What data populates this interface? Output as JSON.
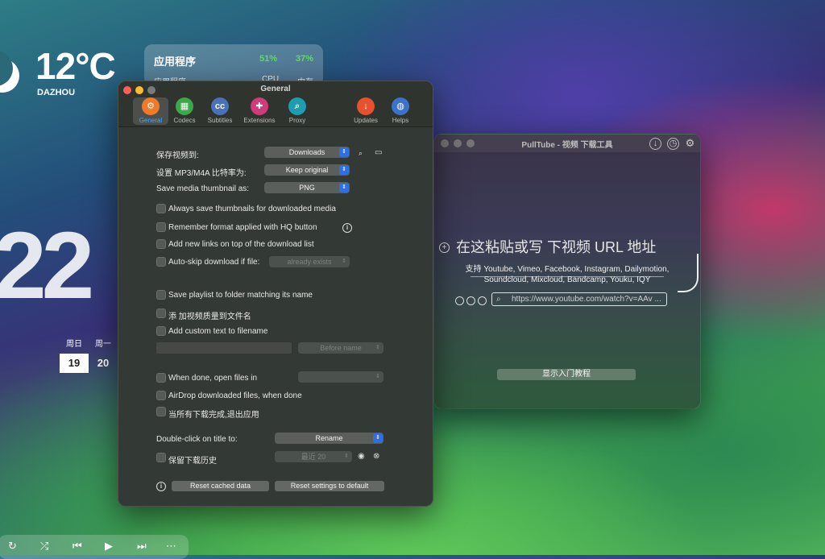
{
  "desktop": {
    "weather": {
      "temp": "12°C",
      "city": "DAZHOU"
    },
    "big_date": "22",
    "calendar": {
      "weekdays": [
        "周日",
        "周一"
      ],
      "days": [
        "19",
        "20"
      ]
    },
    "activity": {
      "title": "应用程序",
      "cpu": "51%",
      "mem": "37%",
      "sub_title": "应用程序",
      "sub_cpu": "CPU",
      "sub_mem": "内存"
    },
    "music": {
      "controls": [
        "↻",
        "⤮",
        "⏮",
        "▶",
        "⏭",
        "⋯"
      ]
    }
  },
  "pulltube": {
    "title": "PullTube - 视频 下载工具",
    "paste_prompt": "在这粘贴或写 下视频 URL 地址",
    "supported_line1": "支持 Youtube, Vimeo, Facebook, Instagram, Dailymotion,",
    "supported_line2": "Soundcloud, Mixcloud, Bandcamp, Youku, IQY",
    "url_placeholder": "https://www.youtube.com/watch?v=AAv ...",
    "guide_button": "显示入门教程",
    "icons": [
      "download-icon",
      "history-icon",
      "gear-icon"
    ]
  },
  "general": {
    "title": "General",
    "toolbar": [
      {
        "label": "General",
        "color": "#f07a2a",
        "glyph": "⚙"
      },
      {
        "label": "Codecs",
        "color": "#3ca84a",
        "glyph": "▦"
      },
      {
        "label": "Subtitles",
        "color": "#4a72b8",
        "glyph": "cc"
      },
      {
        "label": "Extensions",
        "color": "#d23b7a",
        "glyph": "✚"
      },
      {
        "label": "Proxy",
        "color": "#1f9db0",
        "glyph": "⌕"
      },
      {
        "label": "Updates",
        "color": "#e8502e",
        "glyph": "↓"
      },
      {
        "label": "Helps",
        "color": "#3a73c8",
        "glyph": "◍"
      }
    ],
    "save_video_label": "保存视频到:",
    "save_video_value": "Downloads",
    "bitrate_label": "设置 MP3/M4A 比特率为:",
    "bitrate_value": "Keep original",
    "thumb_label": "Save media thumbnail as:",
    "thumb_value": "PNG",
    "opt_always_thumb": "Always save thumbnails for downloaded media",
    "opt_remember_hq": "Remember format applied with HQ button",
    "opt_add_top": "Add new links on top of the download list",
    "opt_autoskip": "Auto-skip download if file:",
    "autoskip_value": "already exists",
    "opt_playlist": "Save playlist to folder matching its name",
    "opt_quality_name": "添 加视频质量到文件名",
    "opt_custom_text": "Add custom text to filename",
    "custom_pos_value": "Before name",
    "opt_done_open": "When done, open files in",
    "opt_airdrop": "AirDrop downloaded files, when done",
    "opt_quit": "当所有下载完成,退出应用",
    "dblclick_label": "Double-click on title to:",
    "dblclick_value": "Rename",
    "opt_history": "保留下载历史",
    "history_value": "最近 20",
    "reset_cache": "Reset cached data",
    "reset_settings": "Reset settings to default"
  }
}
